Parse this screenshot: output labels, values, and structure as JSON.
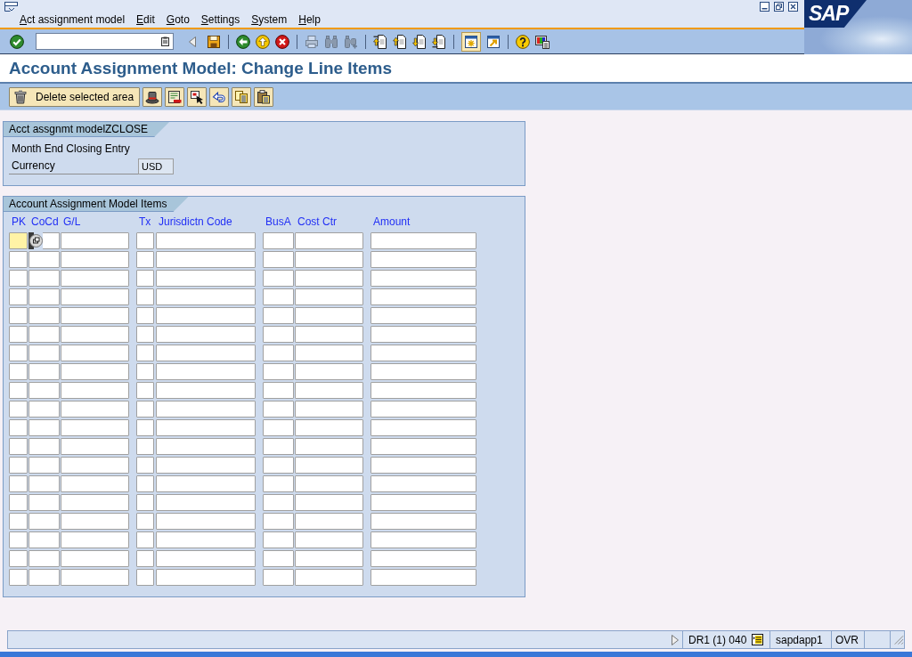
{
  "menu": [
    {
      "label": "Act assignment model"
    },
    {
      "label": "Edit"
    },
    {
      "label": "Goto"
    },
    {
      "label": "Settings"
    },
    {
      "label": "System"
    },
    {
      "label": "Help"
    }
  ],
  "logo": "SAP",
  "toolbar": [
    {
      "items": [
        {
          "kind": "enter",
          "disabled": false,
          "highlighted": false
        },
        {
          "kind": "command",
          "disabled": false,
          "highlighted": false
        },
        {
          "kind": "collapse",
          "disabled": false,
          "highlighted": false
        },
        {
          "kind": "save",
          "disabled": false,
          "highlighted": false
        }
      ]
    },
    {
      "items": [
        {
          "kind": "back",
          "disabled": false,
          "highlighted": false
        },
        {
          "kind": "exit",
          "disabled": false,
          "highlighted": false
        },
        {
          "kind": "cancel",
          "disabled": false,
          "highlighted": false
        }
      ]
    },
    {
      "items": [
        {
          "kind": "print",
          "disabled": true,
          "highlighted": false
        },
        {
          "kind": "find",
          "disabled": true,
          "highlighted": false
        },
        {
          "kind": "find_next",
          "disabled": true,
          "highlighted": false
        }
      ]
    },
    {
      "items": [
        {
          "kind": "first_page",
          "disabled": false,
          "highlighted": false
        },
        {
          "kind": "previous_page",
          "disabled": false,
          "highlighted": false
        },
        {
          "kind": "next_page",
          "disabled": false,
          "highlighted": false
        },
        {
          "kind": "last_page",
          "disabled": false,
          "highlighted": false
        }
      ]
    },
    {
      "items": [
        {
          "kind": "new_session",
          "disabled": false,
          "highlighted": true
        },
        {
          "kind": "shortcut",
          "disabled": false,
          "highlighted": false
        }
      ]
    },
    {
      "items": [
        {
          "kind": "help",
          "disabled": false,
          "highlighted": false
        },
        {
          "kind": "layout",
          "disabled": false,
          "highlighted": false
        }
      ]
    }
  ],
  "title": "Account Assignment Model: Change Line Items",
  "app_toolbar": [
    {
      "kind": "delete",
      "label": "Delete selected area"
    },
    {
      "kind": "other"
    },
    {
      "kind": "details"
    },
    {
      "kind": "select"
    },
    {
      "kind": "undo"
    },
    {
      "kind": "copy"
    },
    {
      "kind": "paste"
    }
  ],
  "model_header": {
    "title": "Acct assgnmt modelZCLOSE",
    "description": "Month End Closing Entry",
    "fields": [
      {
        "label": "Currency",
        "value": "USD",
        "read_only": true
      }
    ]
  },
  "items": {
    "title": "Account Assignment Model Items",
    "columns": [
      {
        "label": "PK"
      },
      {
        "label": "CoCd"
      },
      {
        "label": "G/L"
      },
      {
        "label": "Tx"
      },
      {
        "label": "Jurisdictn Code"
      },
      {
        "label": "BusA"
      },
      {
        "label": "Cost Ctr"
      },
      {
        "label": "Amount"
      }
    ],
    "rows": [
      {
        "focused": true
      },
      {
        "focused": false
      },
      {
        "focused": false
      },
      {
        "focused": false
      },
      {
        "focused": false
      },
      {
        "focused": false
      },
      {
        "focused": false
      },
      {
        "focused": false
      },
      {
        "focused": false
      },
      {
        "focused": false
      },
      {
        "focused": false
      },
      {
        "focused": false
      },
      {
        "focused": false
      },
      {
        "focused": false
      },
      {
        "focused": false
      },
      {
        "focused": false
      },
      {
        "focused": false
      },
      {
        "focused": false
      },
      {
        "focused": false
      }
    ]
  },
  "status_bar": {
    "system": "DR1 (1) 040",
    "server": "sapdapp1",
    "mode": "OVR"
  }
}
